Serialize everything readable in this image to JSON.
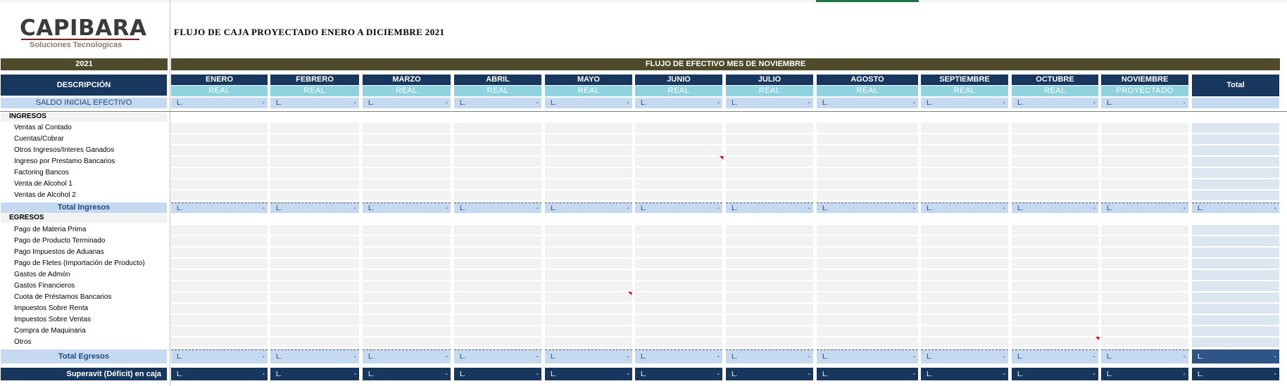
{
  "logo": {
    "brand": "CAPIBARA",
    "tagline": "Soluciones Tecnologicas"
  },
  "title": "FLUJO DE CAJA PROYECTADO ENERO A DICIEMBRE 2021",
  "year_label": "2021",
  "banner": "FLUJO DE EFECTIVO MES DE NOVIEMBRE",
  "description_header": "DESCRIPCIÓN",
  "total_header": "Total",
  "months": [
    {
      "name": "ENERO",
      "status": "REAL"
    },
    {
      "name": "FEBRERO",
      "status": "REAL"
    },
    {
      "name": "MARZO",
      "status": "REAL"
    },
    {
      "name": "ABRIL",
      "status": "REAL"
    },
    {
      "name": "MAYO",
      "status": "REAL"
    },
    {
      "name": "JUNIO",
      "status": "REAL"
    },
    {
      "name": "JULIO",
      "status": "REAL"
    },
    {
      "name": "AGOSTO",
      "status": "REAL"
    },
    {
      "name": "SEPTIEMBRE",
      "status": "REAL"
    },
    {
      "name": "OCTUBRE",
      "status": "REAL"
    },
    {
      "name": "NOVIEMBRE",
      "status": "PROYECTADO"
    }
  ],
  "saldo_inicial_label": "SALDO INICIAL EFECTIVO",
  "currency": "L.",
  "dash_value": "-",
  "ingresos": {
    "header": "INGRESOS",
    "items": [
      "Ventas al Contado",
      "Cuentas/Cobrar",
      "Otros Ingresos/Interes Ganados",
      "Ingreso por Prestamo Bancarios",
      "Factoring Bancos",
      "Venta de Alcohol 1",
      "Ventas de Alcohol 2"
    ],
    "total_label": "Total Ingresos"
  },
  "egresos": {
    "header": "EGRESOS",
    "items": [
      "Pago de Materia Prima",
      "Pago de Producto Terminado",
      "Pago Impuestos de Aduanas",
      "Pago de Fletes (Importación de Producto)",
      "Gastos de Admón",
      "Gastos Financieros",
      "Cuota de Préstamos Bancarios",
      "Impuestos Sobre Renta",
      "Impuestos Sobre Ventas",
      "Compra de Maquinaria",
      "Otros"
    ],
    "total_label": "Total Egresos"
  },
  "superavit_label": "Superavit (Déficit) en caja",
  "colors": {
    "navy": "#17375e",
    "olive": "#4f4a2a",
    "teal": "#8ed3dd",
    "light_blue": "#c5d9f1",
    "grey": "#f2f2f2"
  }
}
